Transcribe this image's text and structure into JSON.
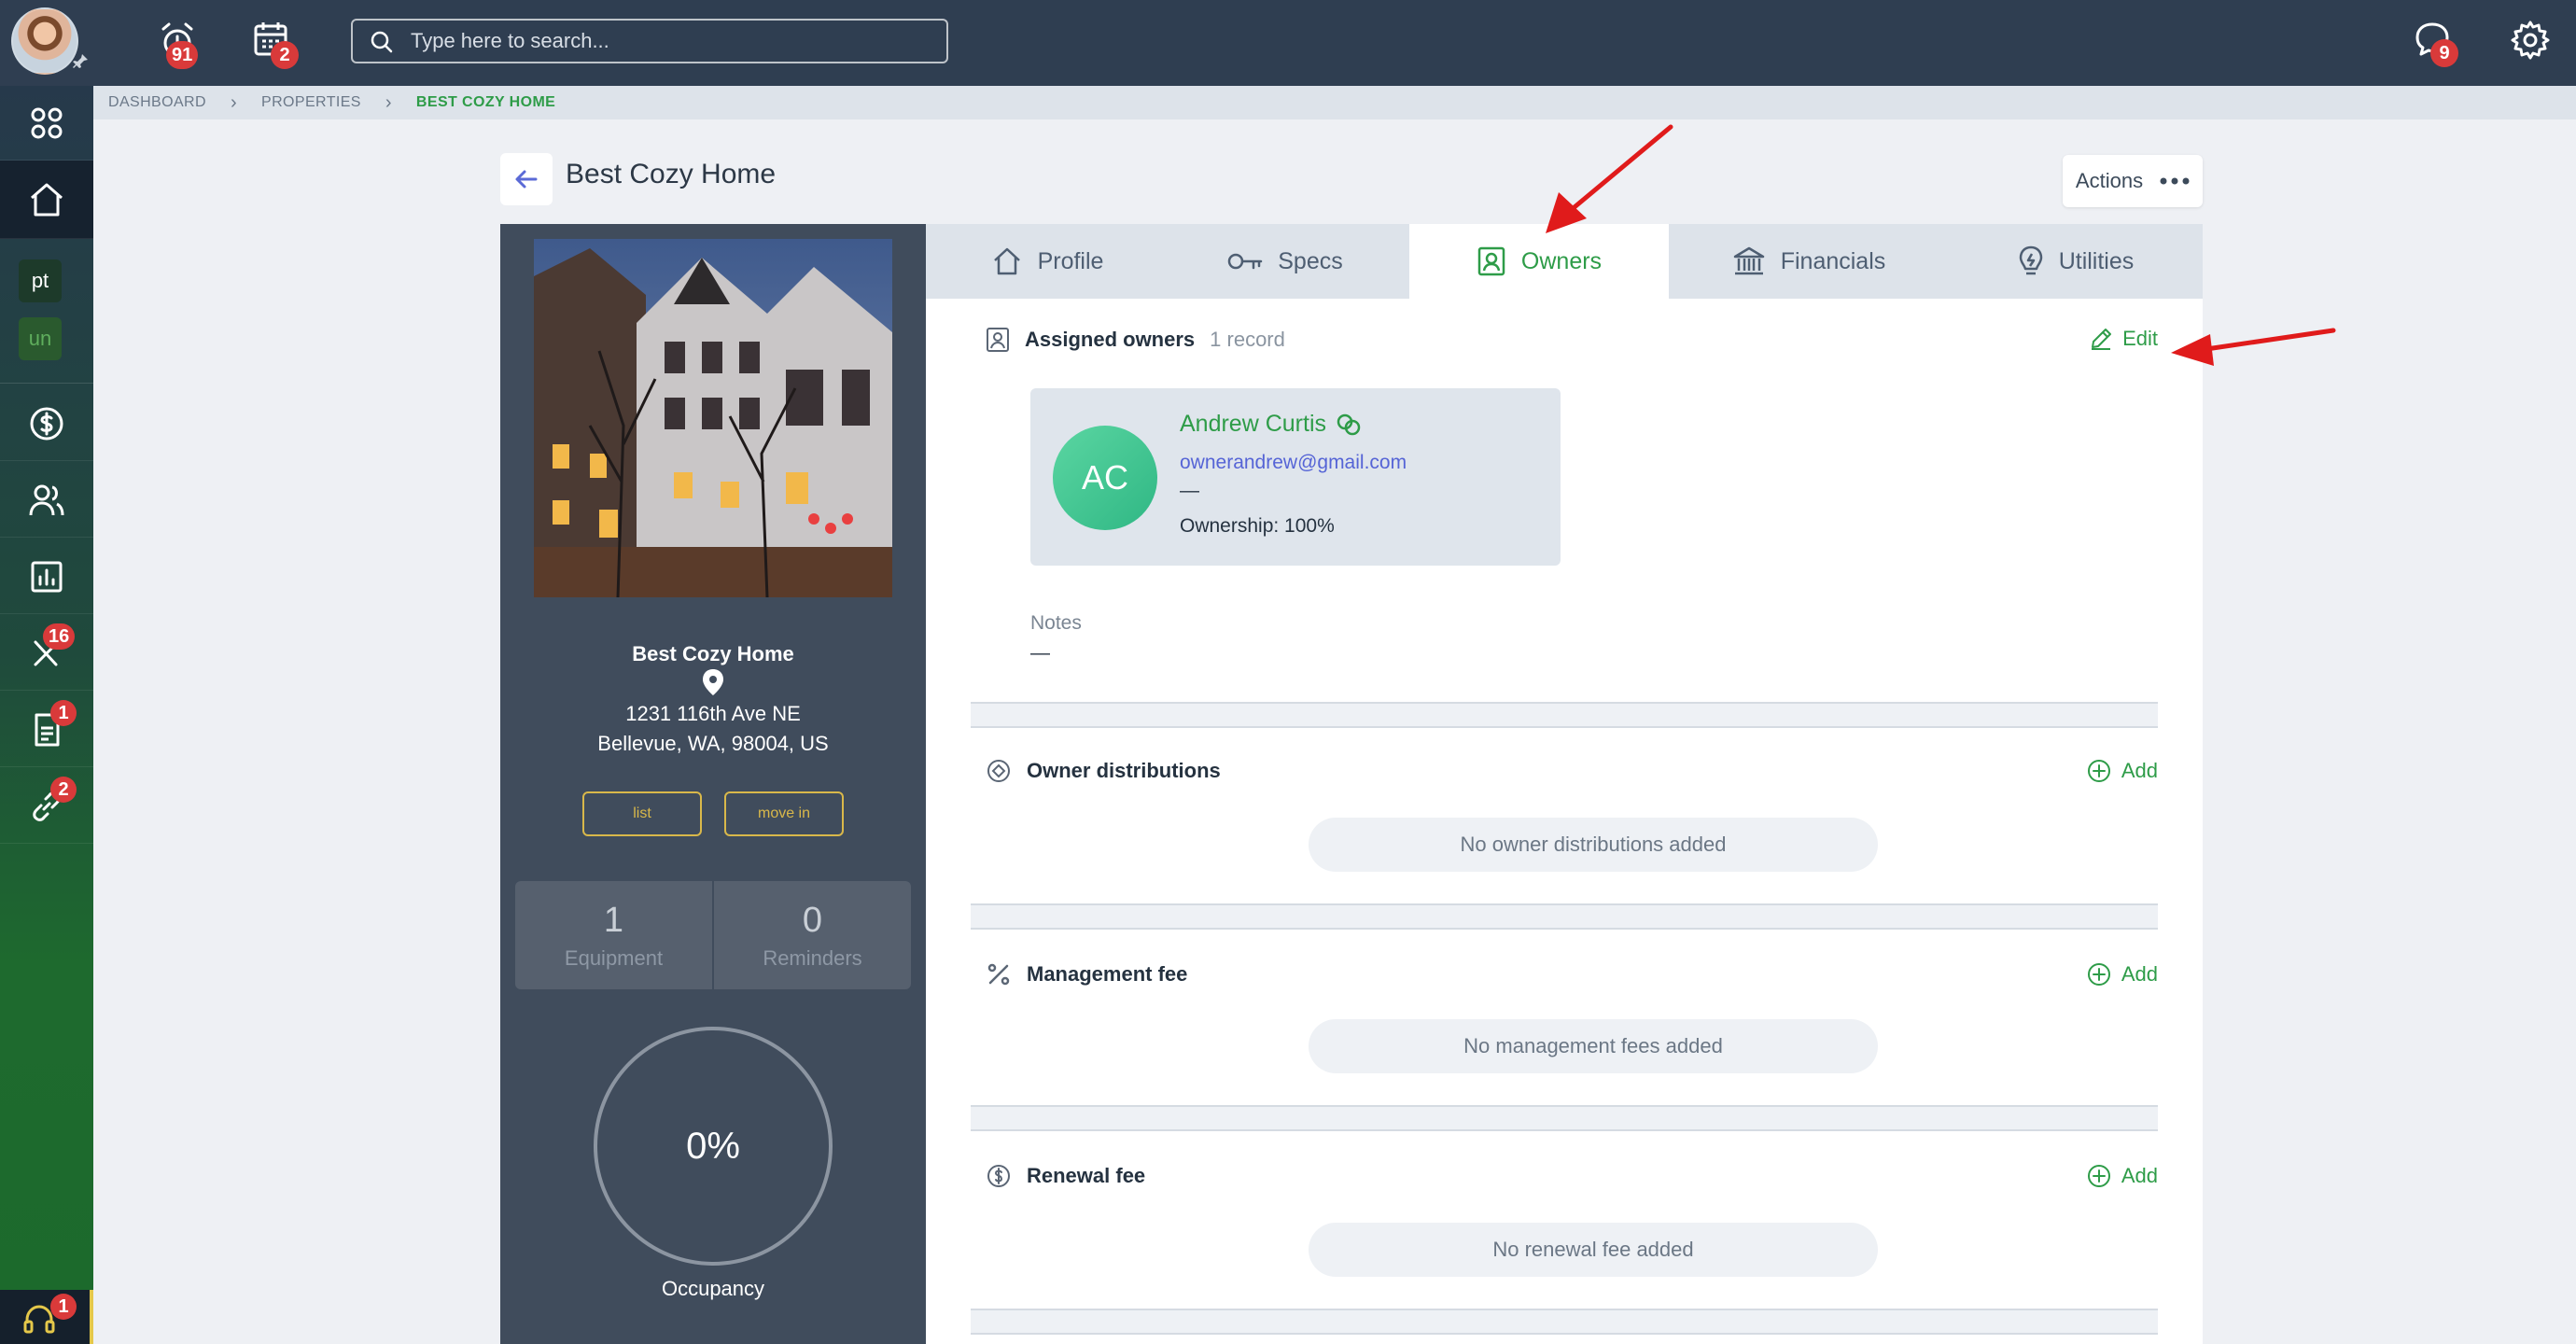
{
  "topbar": {
    "notifications_badge": "91",
    "calendar_badge": "2",
    "search_placeholder": "Type here to search...",
    "messages_badge": "9"
  },
  "sidebar": {
    "tags": [
      "pt",
      "un"
    ],
    "badges": {
      "maintenance": "16",
      "documents": "1",
      "integrations": "2",
      "support": "1"
    }
  },
  "breadcrumb": [
    "DASHBOARD",
    "PROPERTIES",
    "BEST COZY HOME"
  ],
  "header": {
    "title": "Best Cozy Home",
    "actions_label": "Actions"
  },
  "property": {
    "name": "Best Cozy Home",
    "address_line1": "1231 116th Ave NE",
    "address_line2": "Bellevue, WA, 98004, US",
    "btn_list": "list",
    "btn_move_in": "move in",
    "stats": [
      {
        "value": "1",
        "label": "Equipment"
      },
      {
        "value": "0",
        "label": "Reminders"
      }
    ],
    "occupancy_value": "0%",
    "occupancy_label": "Occupancy"
  },
  "tabs": [
    "Profile",
    "Specs",
    "Owners",
    "Financials",
    "Utilities"
  ],
  "active_tab": "Owners",
  "owners_section": {
    "title": "Assigned owners",
    "count": "1 record",
    "edit_label": "Edit",
    "owner": {
      "initials": "AC",
      "name": "Andrew Curtis",
      "email": "ownerandrew@gmail.com",
      "phone": "—",
      "ownership": "Ownership: 100%"
    },
    "notes_label": "Notes",
    "notes_value": "—"
  },
  "distributions": {
    "title": "Owner distributions",
    "add_label": "Add",
    "empty": "No owner distributions added"
  },
  "management_fee": {
    "title": "Management fee",
    "add_label": "Add",
    "empty": "No management fees added"
  },
  "renewal_fee": {
    "title": "Renewal fee",
    "add_label": "Add",
    "empty": "No renewal fee added"
  },
  "colors": {
    "accent": "#2e9c48",
    "topbar": "#2f3e51",
    "badge": "#d93a3a",
    "annotation_arrow": "#e01b1b"
  }
}
